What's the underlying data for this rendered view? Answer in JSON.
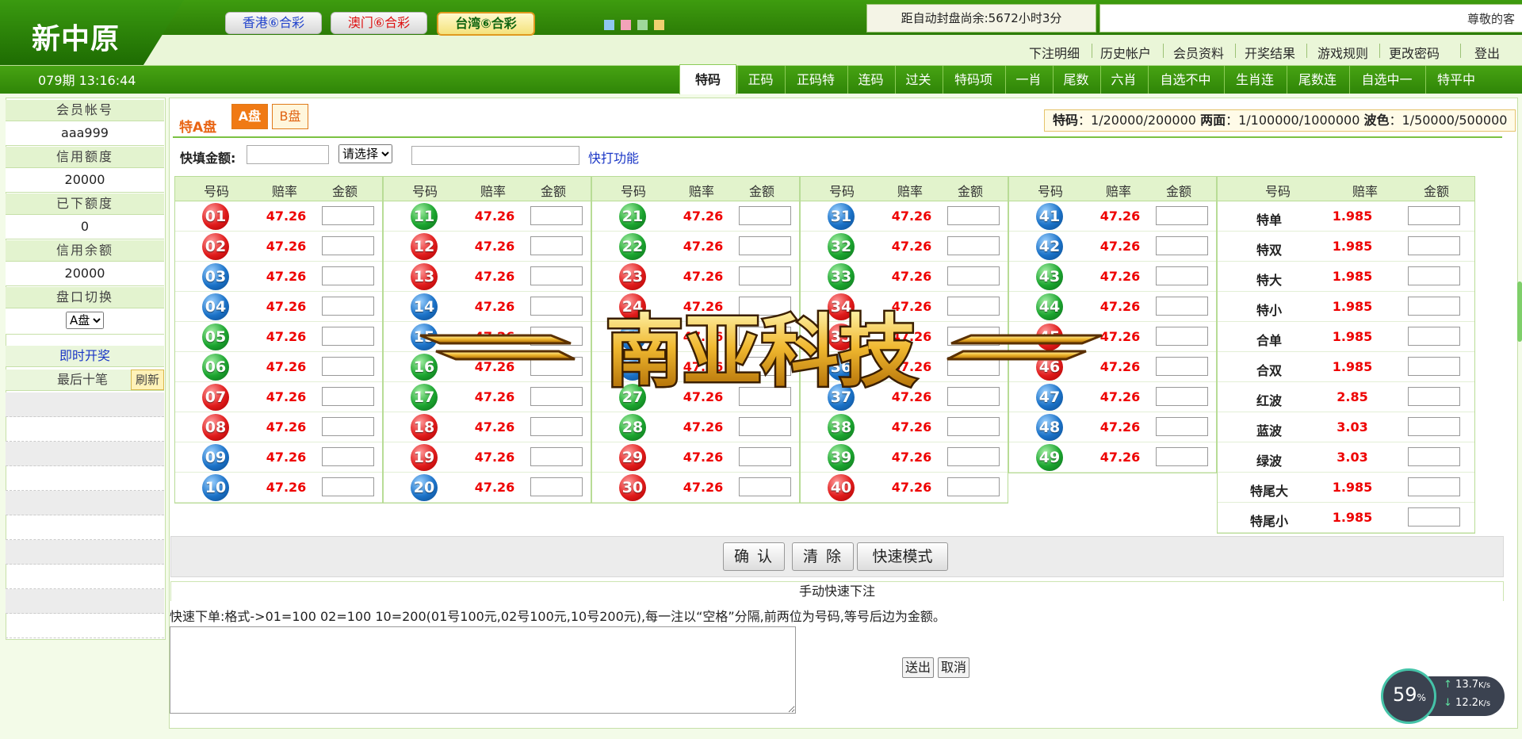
{
  "header": {
    "logo": "新中原",
    "lottery_tabs": [
      "香港⑥合彩",
      "澳门⑥合彩",
      "台湾⑥合彩"
    ],
    "countdown": "距自动封盘尚余:5672小时3分",
    "greeting": "尊敬的客",
    "top_links": [
      "下注明细",
      "历史帐户",
      "会员资料",
      "开奖结果",
      "游戏规则",
      "更改密码",
      "登出"
    ],
    "period": "079期 13:16:44",
    "nav_tabs": [
      "特码",
      "正码",
      "正码特",
      "连码",
      "过关",
      "特码项",
      "一肖",
      "尾数",
      "六肖",
      "自选不中",
      "生肖连",
      "尾数连",
      "自选中一",
      "特平中"
    ],
    "active_tab": "特码"
  },
  "sidebar": {
    "account_label": "会员帐号",
    "account_value": "aaa999",
    "credit_label": "信用额度",
    "credit_value": "20000",
    "used_label": "已下额度",
    "used_value": "0",
    "balance_label": "信用余额",
    "balance_value": "20000",
    "switch_label": "盘口切换",
    "switch_value": "A盘",
    "live_draw": "即时开奖",
    "last_ten": "最后十笔",
    "refresh": "刷新"
  },
  "panel": {
    "title": "特A盘",
    "a_btn": "A盘",
    "b_btn": "B盘",
    "limits": {
      "tema_label": "特码",
      "tema_value": "：1/20000/200000",
      "liangmian_label": "两面",
      "liangmian_value": "：1/100000/1000000",
      "bose_label": "波色",
      "bose_value": "：1/50000/500000"
    },
    "quick_fill_label": "快填金额:",
    "select_placeholder": "请选择",
    "quick_func": "快打功能"
  },
  "table": {
    "col_headers": [
      "号码",
      "赔率",
      "金额"
    ],
    "numbers": [
      {
        "n": "01",
        "c": "red"
      },
      {
        "n": "02",
        "c": "red"
      },
      {
        "n": "03",
        "c": "blue"
      },
      {
        "n": "04",
        "c": "blue"
      },
      {
        "n": "05",
        "c": "green"
      },
      {
        "n": "06",
        "c": "green"
      },
      {
        "n": "07",
        "c": "red"
      },
      {
        "n": "08",
        "c": "red"
      },
      {
        "n": "09",
        "c": "blue"
      },
      {
        "n": "10",
        "c": "blue"
      },
      {
        "n": "11",
        "c": "green"
      },
      {
        "n": "12",
        "c": "red"
      },
      {
        "n": "13",
        "c": "red"
      },
      {
        "n": "14",
        "c": "blue"
      },
      {
        "n": "15",
        "c": "blue"
      },
      {
        "n": "16",
        "c": "green"
      },
      {
        "n": "17",
        "c": "green"
      },
      {
        "n": "18",
        "c": "red"
      },
      {
        "n": "19",
        "c": "red"
      },
      {
        "n": "20",
        "c": "blue"
      },
      {
        "n": "21",
        "c": "green"
      },
      {
        "n": "22",
        "c": "green"
      },
      {
        "n": "23",
        "c": "red"
      },
      {
        "n": "24",
        "c": "red"
      },
      {
        "n": "25",
        "c": "blue"
      },
      {
        "n": "26",
        "c": "blue"
      },
      {
        "n": "27",
        "c": "green"
      },
      {
        "n": "28",
        "c": "green"
      },
      {
        "n": "29",
        "c": "red"
      },
      {
        "n": "30",
        "c": "red"
      },
      {
        "n": "31",
        "c": "blue"
      },
      {
        "n": "32",
        "c": "green"
      },
      {
        "n": "33",
        "c": "green"
      },
      {
        "n": "34",
        "c": "red"
      },
      {
        "n": "35",
        "c": "red"
      },
      {
        "n": "36",
        "c": "blue"
      },
      {
        "n": "37",
        "c": "blue"
      },
      {
        "n": "38",
        "c": "green"
      },
      {
        "n": "39",
        "c": "green"
      },
      {
        "n": "40",
        "c": "red"
      },
      {
        "n": "41",
        "c": "blue"
      },
      {
        "n": "42",
        "c": "blue"
      },
      {
        "n": "43",
        "c": "green"
      },
      {
        "n": "44",
        "c": "green"
      },
      {
        "n": "45",
        "c": "red"
      },
      {
        "n": "46",
        "c": "red"
      },
      {
        "n": "47",
        "c": "blue"
      },
      {
        "n": "48",
        "c": "blue"
      },
      {
        "n": "49",
        "c": "green"
      }
    ],
    "odds": "47.26",
    "special": [
      {
        "label": "特单",
        "odds": "1.985"
      },
      {
        "label": "特双",
        "odds": "1.985"
      },
      {
        "label": "特大",
        "odds": "1.985"
      },
      {
        "label": "特小",
        "odds": "1.985"
      },
      {
        "label": "合单",
        "odds": "1.985"
      },
      {
        "label": "合双",
        "odds": "1.985"
      },
      {
        "label": "红波",
        "odds": "2.85"
      },
      {
        "label": "蓝波",
        "odds": "3.03"
      },
      {
        "label": "绿波",
        "odds": "3.03"
      },
      {
        "label": "特尾大",
        "odds": "1.985"
      },
      {
        "label": "特尾小",
        "odds": "1.985"
      }
    ]
  },
  "actions": {
    "confirm": "确 认",
    "clear": "清 除",
    "fast_mode": "快速模式",
    "manual_title": "手动快速下注",
    "format_hint": "快速下单:格式->01=100 02=100 10=200(01号100元,02号100元,10号200元),每一注以“空格”分隔,前两位为号码,等号后边为金额。",
    "send": "送出",
    "cancel": "取消"
  },
  "watermark": "南亚科技",
  "speed_widget": {
    "percent": "59",
    "percent_sign": "%",
    "up": "13.7",
    "down": "12.2",
    "unit": "K/s"
  },
  "colors": {
    "header_green": "#2c7c06",
    "ball_red": "#e01b1b",
    "ball_blue": "#1b72c8",
    "ball_green": "#1ba52f",
    "odds_red": "#ee0000",
    "accent_orange": "#e86414"
  }
}
